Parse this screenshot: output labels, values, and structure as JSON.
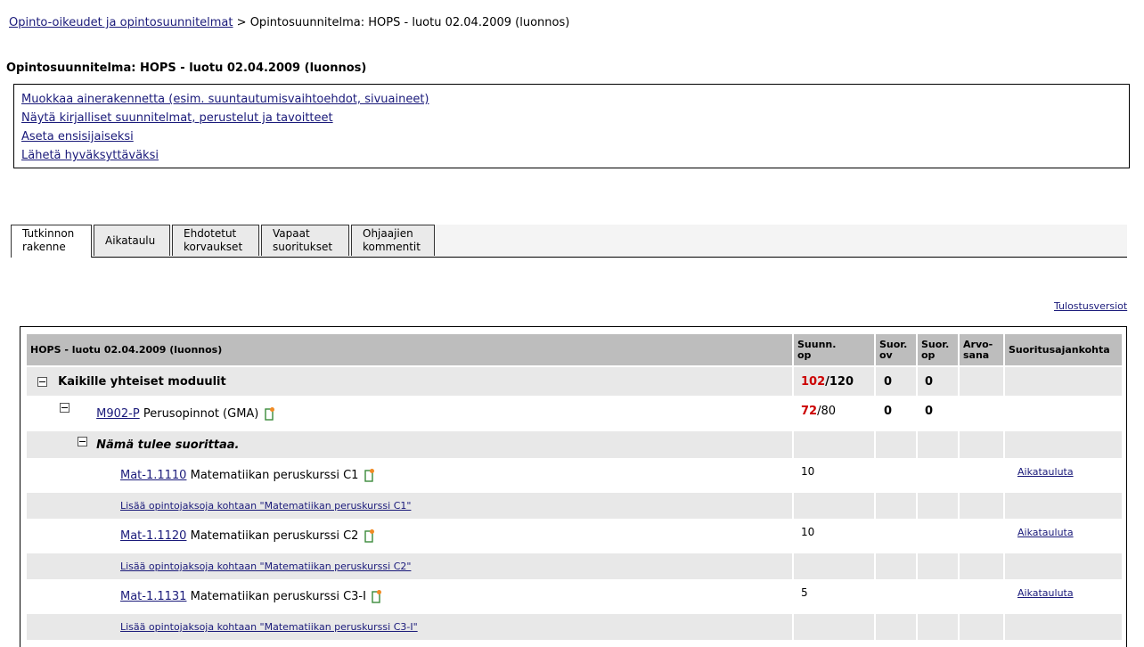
{
  "breadcrumb": {
    "root_link": "Opinto-oikeudet ja opintosuunnitelmat",
    "separator": ">",
    "current": "Opintosuunnitelma: HOPS - luotu 02.04.2009 (luonnos)"
  },
  "page_title": "Opintosuunnitelma: HOPS - luotu 02.04.2009 (luonnos)",
  "actions": [
    "Muokkaa ainerakennetta (esim. suuntautumisvaihtoehdot, sivuaineet)",
    "Näytä kirjalliset suunnitelmat, perustelut ja tavoitteet",
    "Aseta ensisijaiseksi",
    "Lähetä hyväksyttäväksi"
  ],
  "tabs": [
    {
      "line1": "Tutkinnon",
      "line2": "rakenne"
    },
    {
      "line1": "Aikataulu",
      "line2": ""
    },
    {
      "line1": "Ehdotetut",
      "line2": "korvaukset"
    },
    {
      "line1": "Vapaat",
      "line2": "suoritukset"
    },
    {
      "line1": "Ohjaajien",
      "line2": "kommentit"
    }
  ],
  "print_link": "Tulostusversiot",
  "table": {
    "headers": {
      "name": "HOPS - luotu 02.04.2009 (luonnos)",
      "planned_1": "Suunn.",
      "planned_2": "op",
      "done_ov_1": "Suor.",
      "done_ov_2": "ov",
      "done_op_1": "Suor.",
      "done_op_2": "op",
      "grade_1": "Arvo-",
      "grade_2": "sana",
      "date": "Suoritusajankohta"
    },
    "module": {
      "title": "Kaikille yhteiset moduulit",
      "planned": "102",
      "required": "/120",
      "done_ov": "0",
      "done_op": "0"
    },
    "submodule": {
      "code": "M902-P",
      "name": "Perusopinnot (GMA)",
      "planned": "72",
      "required": "/80",
      "done_ov": "0",
      "done_op": "0"
    },
    "group_title": "Nämä tulee suorittaa.",
    "courses": [
      {
        "code": "Mat-1.1110",
        "name": "Matematiikan peruskurssi C1",
        "planned": "10",
        "schedule": "Aikatauluta",
        "add_link": "Lisää opintojaksoja kohtaan \"Matematiikan peruskurssi C1\""
      },
      {
        "code": "Mat-1.1120",
        "name": "Matematiikan peruskurssi C2",
        "planned": "10",
        "schedule": "Aikatauluta",
        "add_link": "Lisää opintojaksoja kohtaan \"Matematiikan peruskurssi C2\""
      },
      {
        "code": "Mat-1.1131",
        "name": "Matematiikan peruskurssi C3-I",
        "planned": "5",
        "schedule": "Aikatauluta",
        "add_link": "Lisää opintojaksoja kohtaan \"Matematiikan peruskurssi C3-I\""
      }
    ]
  },
  "colors": {
    "header_bg": "#bdbdbd",
    "row_shade": "#e8e8e8",
    "link": "#1a1a7a",
    "highlight_red": "#cc0000"
  },
  "icons": {
    "collapse": "minus-box-icon",
    "document": "document-edit-icon"
  }
}
